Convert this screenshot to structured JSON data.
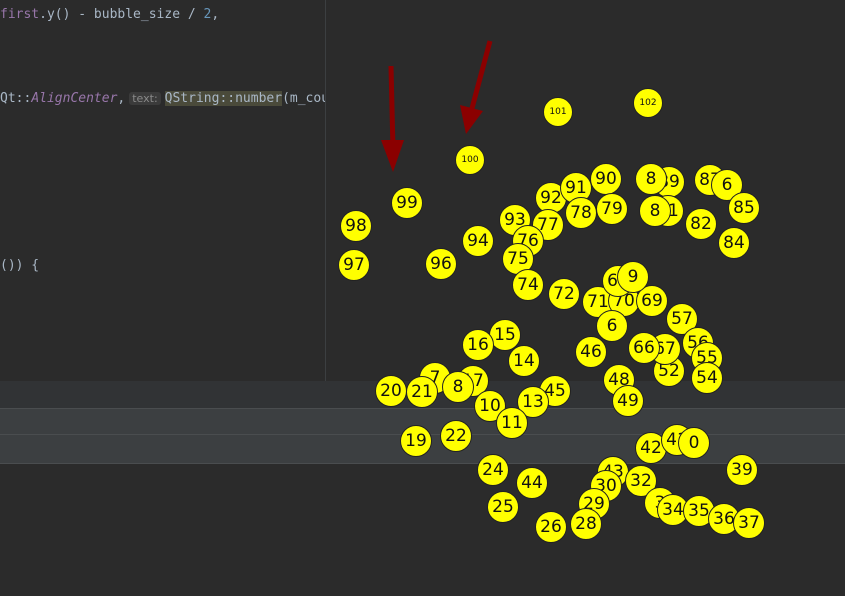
{
  "colors": {
    "bubble": "#ffff00",
    "arrow": "#8b0000",
    "background": "#2b2b2b"
  },
  "editor": {
    "line1": {
      "a": "first",
      "b": ".y() - bubble_size / ",
      "c": "2",
      "d": ","
    },
    "line2": {
      "a": "Qt::",
      "b": "AlignCenter",
      "c": ",",
      "hint": "text:",
      "d": "QString::number",
      "e": "(m_count));"
    },
    "line3": {
      "a": "()) {"
    }
  },
  "bubbles": [
    {
      "label": "101"
    },
    {
      "label": "102"
    },
    {
      "label": "100"
    },
    {
      "label": "99"
    },
    {
      "label": "98"
    },
    {
      "label": "97"
    },
    {
      "label": "96"
    },
    {
      "label": "94"
    },
    {
      "label": "93"
    },
    {
      "label": "92"
    },
    {
      "label": "91"
    },
    {
      "label": "90"
    },
    {
      "label": "89"
    },
    {
      "label": "8"
    },
    {
      "label": "87"
    },
    {
      "label": "6"
    },
    {
      "label": "85"
    },
    {
      "label": "82"
    },
    {
      "label": "81"
    },
    {
      "label": "8"
    },
    {
      "label": "84"
    },
    {
      "label": "79"
    },
    {
      "label": "78"
    },
    {
      "label": "77"
    },
    {
      "label": "76"
    },
    {
      "label": "75"
    },
    {
      "label": "74"
    },
    {
      "label": "72"
    },
    {
      "label": "71"
    },
    {
      "label": "70"
    },
    {
      "label": "69"
    },
    {
      "label": "60"
    },
    {
      "label": "9"
    },
    {
      "label": "57"
    },
    {
      "label": "56"
    },
    {
      "label": "55"
    },
    {
      "label": "54"
    },
    {
      "label": "52"
    },
    {
      "label": "67"
    },
    {
      "label": "66"
    },
    {
      "label": "6"
    },
    {
      "label": "46"
    },
    {
      "label": "48"
    },
    {
      "label": "49"
    },
    {
      "label": "45"
    },
    {
      "label": "15"
    },
    {
      "label": "16"
    },
    {
      "label": "14"
    },
    {
      "label": "17"
    },
    {
      "label": "7"
    },
    {
      "label": "8"
    },
    {
      "label": "20"
    },
    {
      "label": "21"
    },
    {
      "label": "13"
    },
    {
      "label": "10"
    },
    {
      "label": "11"
    },
    {
      "label": "19"
    },
    {
      "label": "22"
    },
    {
      "label": "24"
    },
    {
      "label": "25"
    },
    {
      "label": "44"
    },
    {
      "label": "42"
    },
    {
      "label": "41"
    },
    {
      "label": "0"
    },
    {
      "label": "43"
    },
    {
      "label": "32"
    },
    {
      "label": "30"
    },
    {
      "label": "29"
    },
    {
      "label": "26"
    },
    {
      "label": "28"
    },
    {
      "label": "3"
    },
    {
      "label": "34"
    },
    {
      "label": "35"
    },
    {
      "label": "36"
    },
    {
      "label": "37"
    },
    {
      "label": "39"
    }
  ]
}
